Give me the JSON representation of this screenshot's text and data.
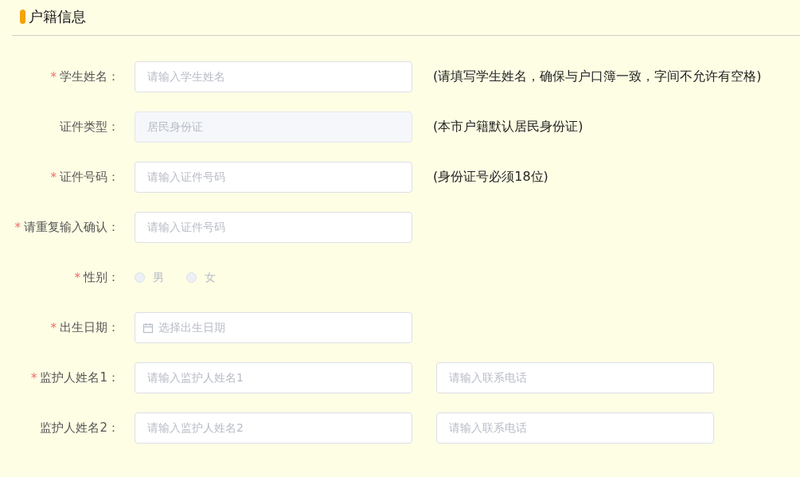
{
  "section": {
    "title": "户籍信息"
  },
  "rows": [
    {
      "kind": "input",
      "mark": "*",
      "label": "学生姓名：",
      "fields": [
        {
          "placeholder": "请输入学生姓名"
        }
      ],
      "hint": "(请填写学生姓名，确保与户口簿一致，字间不允许有空格)"
    },
    {
      "kind": "input",
      "label": "证件类型：",
      "fields": [
        {
          "value": "居民身份证",
          "disabled": true
        }
      ],
      "hint": "(本市户籍默认居民身份证)"
    },
    {
      "kind": "input",
      "mark": "*",
      "label": "证件号码：",
      "fields": [
        {
          "placeholder": "请输入证件号码"
        }
      ],
      "hint": "(身份证号必须18位)"
    },
    {
      "kind": "input",
      "mark": "*",
      "label": "请重复输入确认：",
      "fields": [
        {
          "placeholder": "请输入证件号码"
        }
      ]
    },
    {
      "kind": "radio",
      "mark": "*",
      "label": "性别：",
      "disabled": true,
      "options": [
        {
          "label": "男",
          "selected": false
        },
        {
          "label": "女",
          "selected": false
        }
      ]
    },
    {
      "kind": "date",
      "mark": "*",
      "label": "出生日期：",
      "fields": [
        {
          "placeholder": "选择出生日期"
        }
      ]
    },
    {
      "kind": "input",
      "mark": "*",
      "label": "监护人姓名1：",
      "fields": [
        {
          "placeholder": "请输入监护人姓名1"
        },
        {
          "placeholder": "请输入联系电话"
        }
      ]
    },
    {
      "kind": "input",
      "label": "监护人姓名2：",
      "fields": [
        {
          "placeholder": "请输入监护人姓名2"
        },
        {
          "placeholder": "请输入联系电话"
        }
      ]
    }
  ]
}
